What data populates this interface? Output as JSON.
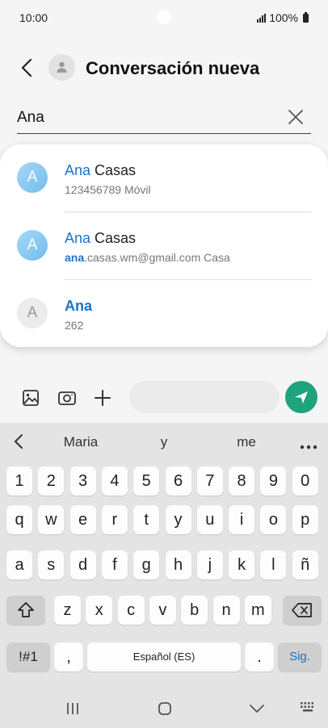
{
  "status_bar": {
    "time": "10:00",
    "battery": "100%"
  },
  "header": {
    "title": "Conversación nueva"
  },
  "recipient": {
    "value": "Ana"
  },
  "suggestions": [
    {
      "initial": "A",
      "name_match": "Ana",
      "name_rest": " Casas",
      "detail_match": "",
      "detail_rest": "123456789  Móvil"
    },
    {
      "initial": "A",
      "name_match": "Ana",
      "name_rest": " Casas",
      "detail_match": "ana",
      "detail_rest": ".casas.wm@gmail.com  Casa"
    },
    {
      "initial": "A",
      "name_match": "Ana",
      "name_rest": "",
      "detail_match": "",
      "detail_rest": "262"
    }
  ],
  "keyboard": {
    "suggestions": [
      "Maria",
      "y",
      "me"
    ],
    "row_numbers": [
      "1",
      "2",
      "3",
      "4",
      "5",
      "6",
      "7",
      "8",
      "9",
      "0"
    ],
    "row1": [
      "q",
      "w",
      "e",
      "r",
      "t",
      "y",
      "u",
      "i",
      "o",
      "p"
    ],
    "row2": [
      "a",
      "s",
      "d",
      "f",
      "g",
      "h",
      "j",
      "k",
      "l",
      "ñ"
    ],
    "row3": [
      "z",
      "x",
      "c",
      "v",
      "b",
      "n",
      "m"
    ],
    "symbols_key": "!#1",
    "comma_key": ",",
    "space_key": "Español (ES)",
    "period_key": ".",
    "enter_key": "Sig."
  },
  "colors": {
    "accent": "#1a73c9",
    "send_button": "#1ea37d",
    "keyboard_bg": "#e4e4e4"
  }
}
